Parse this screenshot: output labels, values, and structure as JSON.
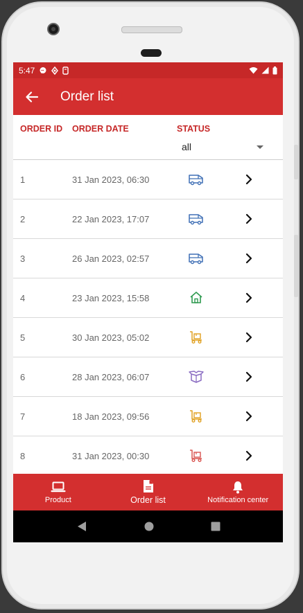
{
  "status_bar": {
    "time": "5:47"
  },
  "app_bar": {
    "title": "Order list"
  },
  "table": {
    "headers": {
      "id": "ORDER ID",
      "date": "ORDER DATE",
      "status": "STATUS"
    },
    "filter_value": "all",
    "rows": [
      {
        "id": "1",
        "date": "31 Jan 2023, 06:30",
        "status_icon": "van-icon",
        "color": "#3f6fb5"
      },
      {
        "id": "2",
        "date": "22 Jan 2023, 17:07",
        "status_icon": "van-icon",
        "color": "#3f6fb5"
      },
      {
        "id": "3",
        "date": "26 Jan 2023, 02:57",
        "status_icon": "van-icon",
        "color": "#3f6fb5"
      },
      {
        "id": "4",
        "date": "23 Jan 2023, 15:58",
        "status_icon": "house-icon",
        "color": "#2e9a4f"
      },
      {
        "id": "5",
        "date": "30 Jan 2023, 05:02",
        "status_icon": "hand-truck-icon",
        "color": "#e0a020"
      },
      {
        "id": "6",
        "date": "28 Jan 2023, 06:07",
        "status_icon": "open-box-icon",
        "color": "#8a6cc2"
      },
      {
        "id": "7",
        "date": "18 Jan 2023, 09:56",
        "status_icon": "hand-truck-icon",
        "color": "#e0a020"
      },
      {
        "id": "8",
        "date": "31 Jan 2023, 00:30",
        "status_icon": "hand-truck-icon",
        "color": "#d9534f"
      }
    ]
  },
  "bottom_nav": {
    "items": [
      {
        "label": "Product",
        "icon": "laptop-icon"
      },
      {
        "label": "Order list",
        "icon": "document-icon"
      },
      {
        "label": "Notification center",
        "icon": "bell-icon"
      }
    ],
    "active": "Order list"
  }
}
